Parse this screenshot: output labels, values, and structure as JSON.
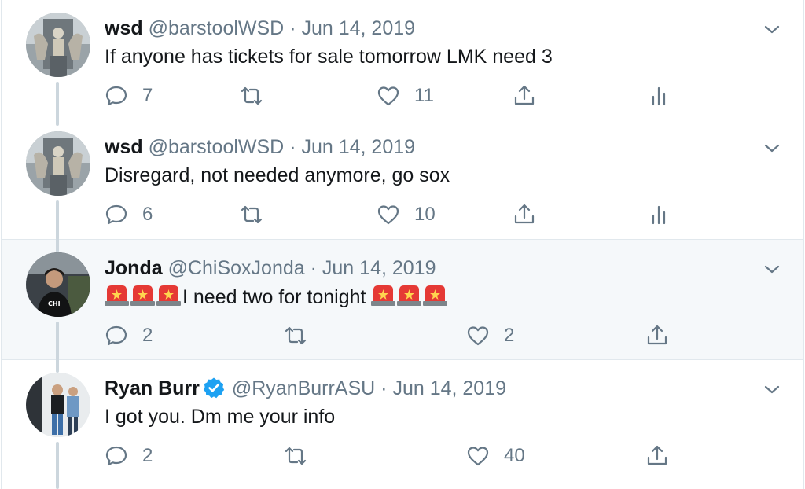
{
  "colors": {
    "text": "#14171a",
    "secondary": "#657786",
    "border": "#e1e8ed",
    "highlight_bg": "#f5f8fa",
    "thread_line": "#ccd6dd",
    "verified": "#1da1f2"
  },
  "tweets": [
    {
      "name": "wsd",
      "handle": "@barstoolWSD",
      "dot": "·",
      "date": "Jun 14, 2019",
      "text": "If anyone has tickets for sale tomorrow LMK need 3",
      "reply_count": "7",
      "like_count": "11",
      "verified": false
    },
    {
      "name": "wsd",
      "handle": "@barstoolWSD",
      "dot": "·",
      "date": "Jun 14, 2019",
      "text": "Disregard, not needed anymore, go sox",
      "reply_count": "6",
      "like_count": "10",
      "verified": false
    },
    {
      "name": "Jonda",
      "handle": "@ChiSoxJonda",
      "dot": "·",
      "date": "Jun 14, 2019",
      "text": "I need two for tonight",
      "reply_count": "2",
      "like_count": "2",
      "verified": false,
      "emoji": "police-car-light-icon"
    },
    {
      "name": "Ryan Burr",
      "handle": "@RyanBurrASU",
      "dot": "·",
      "date": "Jun 14, 2019",
      "text": "I got you. Dm me your info",
      "reply_count": "2",
      "like_count": "40",
      "verified": true
    }
  ]
}
